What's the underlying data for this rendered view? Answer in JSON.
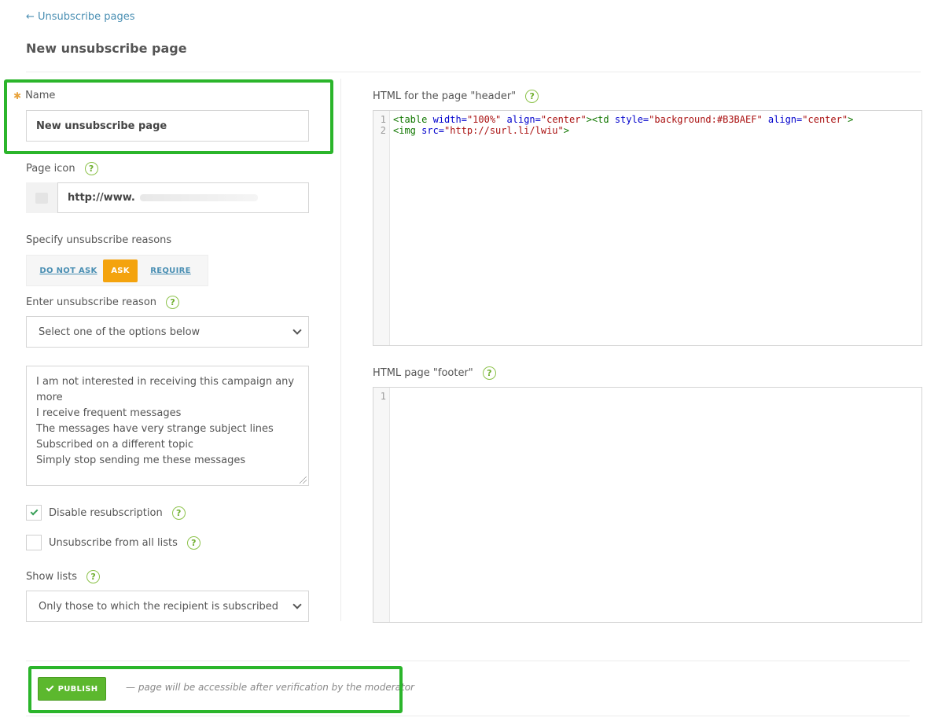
{
  "header": {
    "back_link": "← Unsubscribe pages",
    "title": "New unsubscribe page"
  },
  "form": {
    "name": {
      "label": "Name",
      "value": "New unsubscribe page"
    },
    "page_icon": {
      "label": "Page icon",
      "url_value": "http://www."
    },
    "reasons_mode": {
      "label": "Specify unsubscribe reasons",
      "options": [
        "DO NOT ASK",
        "ASK",
        "REQUIRE"
      ],
      "selected": "ASK"
    },
    "enter_reason": {
      "label": "Enter unsubscribe reason",
      "select_value": "Select one of the options below",
      "reasons": [
        "I am not interested in receiving this campaign any more",
        "I receive frequent messages",
        "The messages have very strange subject lines",
        "Subscribed on a different topic",
        "Simply stop sending me these messages"
      ]
    },
    "disable_resubscription": {
      "label": "Disable resubscription",
      "checked": true
    },
    "unsubscribe_all": {
      "label": "Unsubscribe from all lists",
      "checked": false
    },
    "show_lists": {
      "label": "Show lists",
      "select_value": "Only those to which the recipient is subscribed"
    }
  },
  "editors": {
    "header": {
      "label": "HTML for the page \"header\"",
      "line_numbers": [
        "1",
        "2"
      ]
    },
    "footer": {
      "label": "HTML page \"footer\"",
      "line_numbers": [
        "1"
      ]
    }
  },
  "code": {
    "l1": {
      "t1": "<table ",
      "a1": "width=",
      "s1": "\"100%\"",
      "sp1": " ",
      "a2": "align=",
      "s2": "\"center\"",
      "t2": "><td ",
      "a3": "style=",
      "s3": "\"background:#B3BAEF\"",
      "sp2": " ",
      "a4": "align=",
      "s4": "\"center\"",
      "t3": ">"
    },
    "l2": {
      "t1": "<img ",
      "a1": "src=",
      "s1": "\"http://surl.li/lwiu\"",
      "t2": ">"
    }
  },
  "footer_bar": {
    "publish_label": "PUBLISH",
    "note": "— page will be accessible after verification by the moderator"
  },
  "colors": {
    "accent_link": "#4a8fb3",
    "active_toggle": "#f4a30d",
    "publish_green": "#5cb82e",
    "highlight_green": "#2bb52b"
  }
}
